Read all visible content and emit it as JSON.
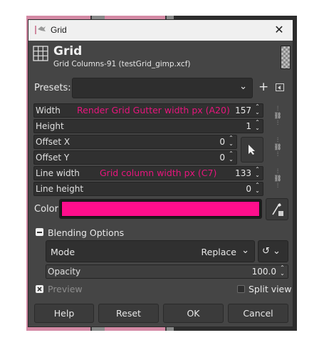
{
  "window": {
    "title": "Grid",
    "close_glyph": "✕"
  },
  "header": {
    "title": "Grid",
    "subtitle": "Grid Columns-91 (testGrid_gimp.xcf)",
    "icon": "grid-icon",
    "preview_icon": "checkerboard-icon"
  },
  "presets": {
    "label": "Presets:",
    "value": "",
    "chevron": "⌄",
    "add": "+",
    "menu_icon": "menu-arrow-icon"
  },
  "fields": {
    "width": {
      "label": "Width",
      "value": "157",
      "annotation": "Render Grid Gutter width px (A20)"
    },
    "height": {
      "label": "Height",
      "value": "1"
    },
    "offset_x": {
      "label": "Offset X",
      "value": "0"
    },
    "offset_y": {
      "label": "Offset Y",
      "value": "0"
    },
    "line_width": {
      "label": "Line width",
      "value": "133",
      "annotation": "Grid column width px (C7)"
    },
    "line_height": {
      "label": "Line height",
      "value": "0"
    }
  },
  "spin_arrows": "⌃⌄",
  "chain_glyph": "⛓",
  "pointer_glyph": "➤",
  "color": {
    "label": "Color",
    "value": "#ff0e8c"
  },
  "blending": {
    "label": "Blending Options",
    "mode_label": "Mode",
    "mode_value": "Replace",
    "mode_chevron": "⌄",
    "composite_glyph": "↺ ⌄",
    "opacity_label": "Opacity",
    "opacity_value": "100.0"
  },
  "preview": {
    "label": "Preview",
    "checked": true
  },
  "split_view": {
    "label": "Split view",
    "checked": false
  },
  "buttons": {
    "help": "Help",
    "reset": "Reset",
    "ok": "OK",
    "cancel": "Cancel"
  },
  "colors": {
    "accent_pink": "#ff0e8c",
    "annotation_pink": "#e8157d",
    "dialog_bg": "#454545"
  }
}
